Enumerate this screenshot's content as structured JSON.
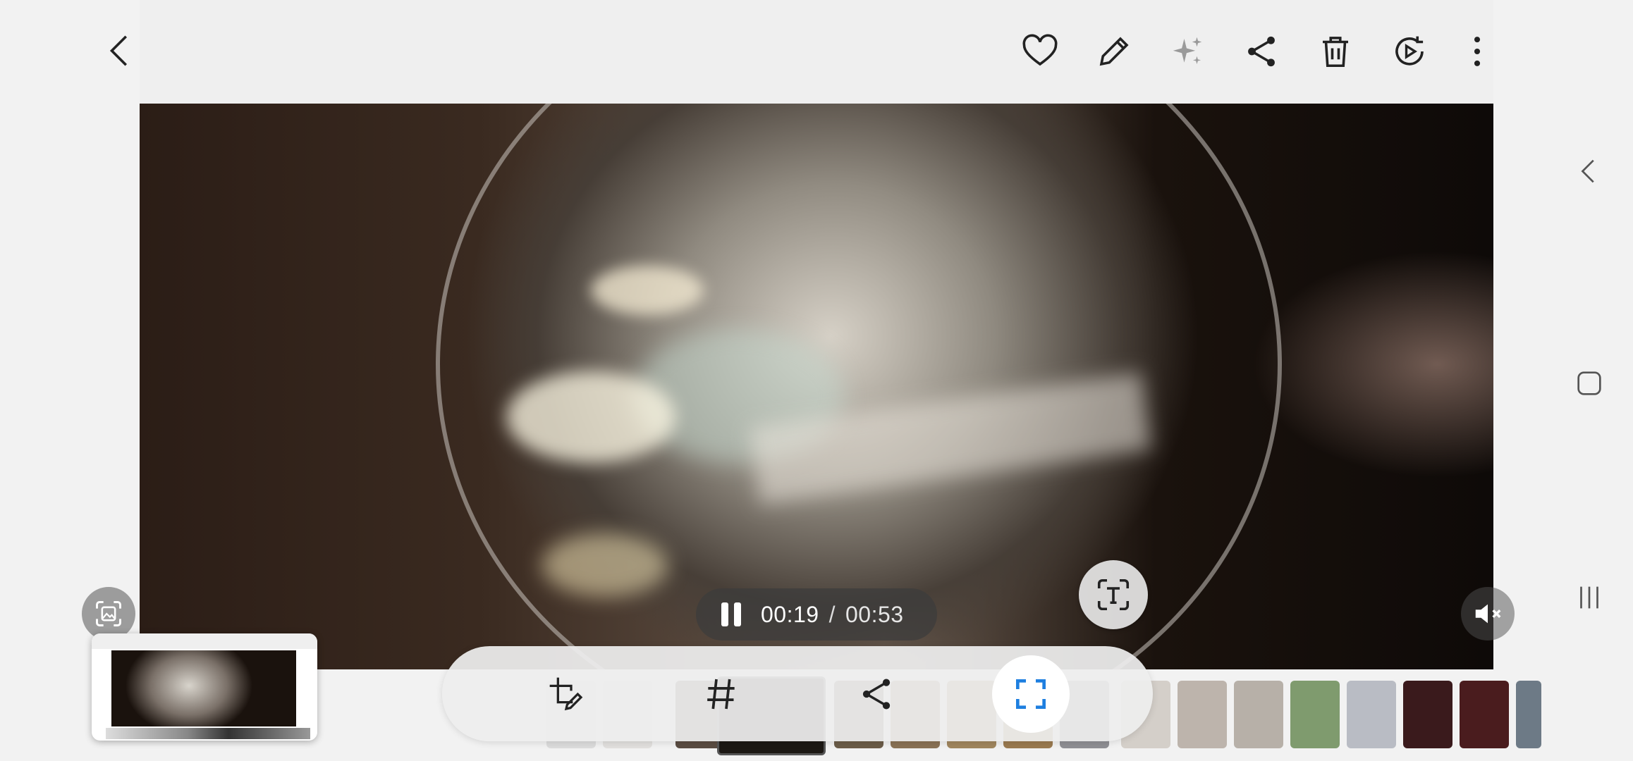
{
  "topbar": {
    "actions": [
      "back",
      "favorite",
      "edit",
      "ai-edit",
      "share",
      "delete",
      "remaster",
      "more"
    ]
  },
  "player": {
    "current_time": "00:19",
    "separator": "/",
    "duration": "00:53"
  },
  "toolbar": {
    "items": [
      "crop-edit",
      "tags",
      "share",
      "capture"
    ]
  },
  "colors": {
    "accent": "#1e7fe0",
    "icon": "#222222"
  }
}
